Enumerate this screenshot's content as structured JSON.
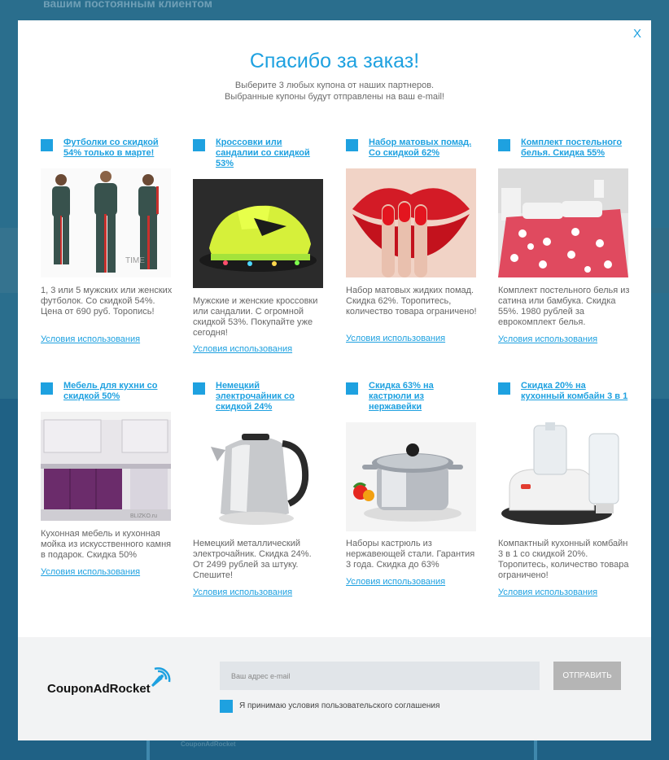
{
  "background": {
    "top_text": "вашим постоянным клиентом",
    "frame_text": "CouponAdRocket"
  },
  "modal": {
    "close_label": "X",
    "title": "Спасибо за заказ!",
    "subtitle_line1": "Выберите 3 любых купона от наших партнеров.",
    "subtitle_line2": "Выбранные купоны будут отправлены на ваш e-mail!",
    "terms_label": "Условия использования"
  },
  "coupons": [
    {
      "title": "Футболки со скидкой 54% только в марте!",
      "image": "tracksuit-photo",
      "desc": "1, 3 или 5 мужских или женских футболок. Со скидкой 54%. Цена от 690 руб. Торопись!",
      "selected": true
    },
    {
      "title": "Кроссовки или сандалии со скидкой 53%",
      "image": "sneakers-photo",
      "desc": "Мужские и женские кроссовки или сандалии. С огромной скидкой 53%. Покупайте уже сегодня!",
      "selected": true
    },
    {
      "title": "Набор матовых помад. Со скидкой 62%",
      "image": "lips-photo",
      "desc": "Набор матовых жидких помад. Скидка 62%. Торопитесь, количество товара ограничено!",
      "selected": true
    },
    {
      "title": "Комплект постельного белья. Скидка 55%",
      "image": "bedding-photo",
      "desc": "Комплект постельного белья из сатина или бамбука. Скидка 55%. 1980 рублей за еврокомплект белья.",
      "selected": true
    },
    {
      "title": "Мебель для кухни со скидкой 50%",
      "image": "kitchen-photo",
      "desc": "Кухонная мебель и кухонная мойка из искусственного камня в подарок. Скидка 50%",
      "selected": true
    },
    {
      "title": "Немецкий электрочайник со скидкой 24%",
      "image": "kettle-photo",
      "desc": "Немецкий металлический электрочайник. Скидка 24%. От 2499 рублей за штуку. Спешите!",
      "selected": true
    },
    {
      "title": "Скидка 63% на кастрюли из нержавейки",
      "image": "pot-photo",
      "desc": "Наборы кастрюль из нержавеющей стали. Гарантия 3 года. Скидка до 63%",
      "selected": true
    },
    {
      "title": "Скидка 20% на кухонный комбайн 3 в 1",
      "image": "food-processor-photo",
      "desc": "Компактный кухонный комбайн 3 в 1 со скидкой 20%. Торопитесь, количество товара ограничено!",
      "selected": true
    }
  ],
  "footer": {
    "logo": "CouponAdRocket",
    "email_placeholder": "Ваш адрес e-mail",
    "send_label": "ОТПРАВИТЬ",
    "agree_label": "Я принимаю условия пользовательского соглашения",
    "agree_checked": true
  },
  "colors": {
    "accent": "#1ea1e0",
    "overlay": "#2a6e8d",
    "button": "#b5b5b5"
  }
}
